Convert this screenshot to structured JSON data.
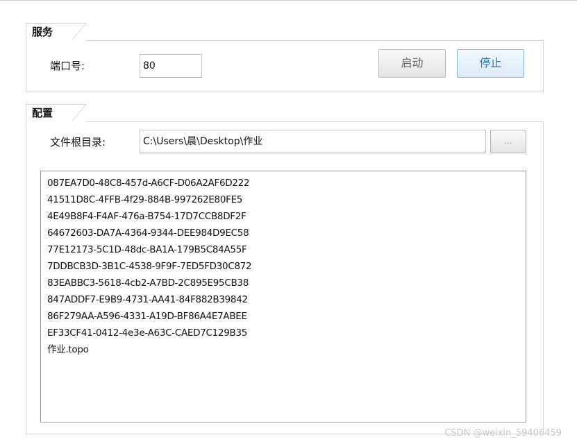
{
  "service": {
    "title": "服务",
    "port_label": "端口号:",
    "port_value": "80",
    "start_button": "启动",
    "stop_button": "停止"
  },
  "config": {
    "title": "配置",
    "root_label": "文件根目录:",
    "root_value": "C:\\Users\\晨\\Desktop\\作业",
    "browse_button": "...",
    "files": [
      "087EA7D0-48C8-457d-A6CF-D06A2AF6D222",
      "41511D8C-4FFB-4f29-884B-997262E80FE5",
      "4E49B8F4-F4AF-476a-B754-17D7CCB8DF2F",
      "64672603-DA7A-4364-9344-DEE984D9EC58",
      "77E12173-5C1D-48dc-BA1A-179B5C84A55F",
      "7DDBCB3D-3B1C-4538-9F9F-7ED5FD30C872",
      "83EABBC3-5618-4cb2-A7BD-2C895E95CB38",
      "847ADDF7-E9B9-4731-AA41-84F882B39842",
      "86F279AA-A596-4331-A19D-BF86A4E7ABEE",
      "EF33CF41-0412-4e3e-A63C-CAED7C129B35",
      "作业.topo"
    ]
  },
  "watermark": "CSDN @weixin_59406459"
}
